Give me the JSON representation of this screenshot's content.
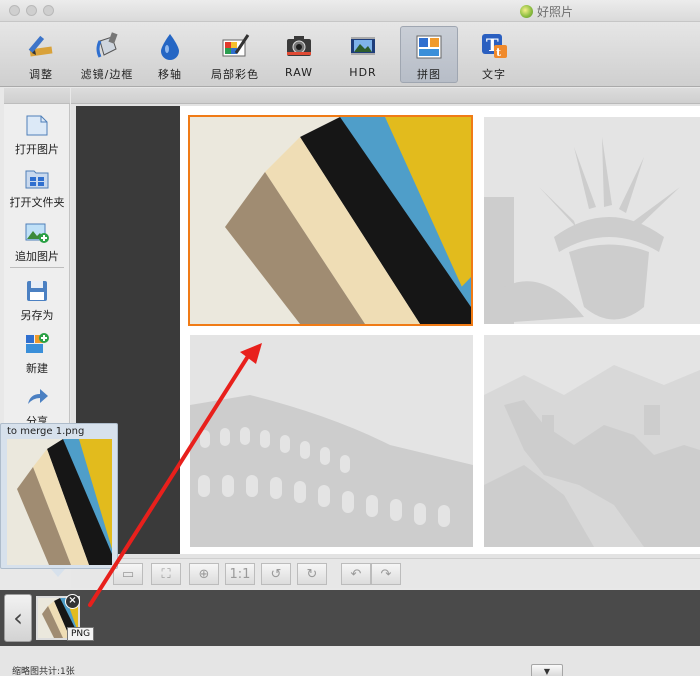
{
  "window": {
    "title": "好照片"
  },
  "toolbar": {
    "items": [
      {
        "label": "调整",
        "icon": "ruler-pencil-icon"
      },
      {
        "label": "滤镜/边框",
        "icon": "paint-bucket-icon"
      },
      {
        "label": "移轴",
        "icon": "water-drop-icon"
      },
      {
        "label": "局部彩色",
        "icon": "color-brush-icon"
      },
      {
        "label": "RAW",
        "icon": "camera-icon"
      },
      {
        "label": "HDR",
        "icon": "hdr-film-icon"
      },
      {
        "label": "拼图",
        "icon": "collage-icon"
      },
      {
        "label": "文字",
        "icon": "text-t-icon"
      }
    ],
    "active": "拼图"
  },
  "sidebar": {
    "items": [
      {
        "label": "打开图片",
        "icon": "open-image-icon"
      },
      {
        "label": "打开文件夹",
        "icon": "open-folder-icon"
      },
      {
        "label": "追加图片",
        "icon": "add-image-icon"
      },
      {
        "label": "另存为",
        "icon": "save-disk-icon"
      },
      {
        "label": "新建",
        "icon": "new-collage-icon"
      },
      {
        "label": "分享",
        "icon": "share-icon"
      }
    ]
  },
  "controls": {
    "one_to_one": "1:1"
  },
  "filmstrip": {
    "back": "‹",
    "thumb_badge": "PNG",
    "remove": "×"
  },
  "drag_preview": {
    "filename": "to merge 1.png"
  },
  "status": {
    "count_text": "缩略图共计:1张",
    "dropdown": "▼"
  },
  "colors": {
    "accent_selection": "#f07b16",
    "arrow": "#e8201c"
  }
}
